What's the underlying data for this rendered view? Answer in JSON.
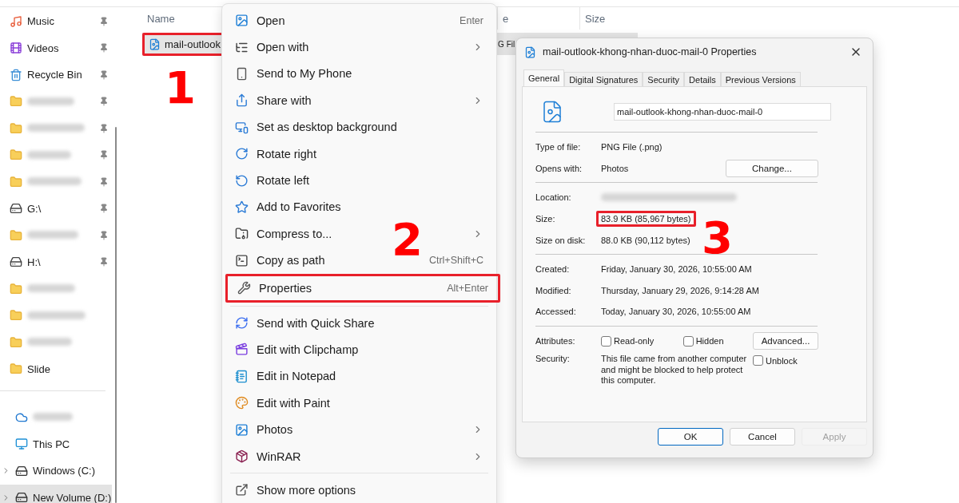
{
  "explorer": {
    "sidebar": {
      "items": [
        {
          "kind": "music",
          "label": "Music",
          "pinned": true,
          "selected": false
        },
        {
          "kind": "videos",
          "label": "Videos",
          "pinned": true,
          "selected": false
        },
        {
          "kind": "recycle",
          "label": "Recycle Bin",
          "pinned": true,
          "selected": false
        },
        {
          "kind": "folder",
          "pinned": true,
          "selected": false
        },
        {
          "kind": "folder",
          "pinned": true,
          "selected": false
        },
        {
          "kind": "folder",
          "pinned": true,
          "selected": false
        },
        {
          "kind": "folder",
          "pinned": true,
          "selected": false
        },
        {
          "kind": "netdrive",
          "label": "G:\\",
          "pinned": true,
          "selected": false
        },
        {
          "kind": "folder",
          "pinned": true,
          "selected": false
        },
        {
          "kind": "netdrive",
          "label": "H:\\",
          "pinned": true,
          "selected": false
        },
        {
          "kind": "folder",
          "pinned": false,
          "selected": false
        },
        {
          "kind": "folder",
          "pinned": false,
          "selected": false
        },
        {
          "kind": "folder",
          "pinned": false,
          "selected": false
        },
        {
          "kind": "folder",
          "label": "Slide",
          "pinned": false,
          "selected": false
        }
      ],
      "computer": [
        {
          "kind": "cloud",
          "selected": false,
          "expandable": false
        },
        {
          "kind": "pc",
          "label": "This PC",
          "selected": false,
          "expandable": false
        },
        {
          "kind": "disk",
          "label": "Windows (C:)",
          "selected": false,
          "expandable": true
        },
        {
          "kind": "disk",
          "label": "New Volume (D:)",
          "selected": true,
          "expandable": true
        }
      ]
    },
    "columns": [
      {
        "label": "Name"
      },
      {
        "label": "e"
      },
      {
        "label": "Size"
      }
    ],
    "files": [
      {
        "name": "mail-outlook",
        "type": "G Fil",
        "selected": true
      }
    ]
  },
  "context_menu": {
    "items": [
      {
        "kind": "item",
        "label": "Open",
        "shortcut": "Enter",
        "submenu": false
      },
      {
        "kind": "item",
        "label": "Open with",
        "submenu": true
      },
      {
        "kind": "item",
        "label": "Send to My Phone",
        "submenu": false
      },
      {
        "kind": "item",
        "label": "Share with",
        "submenu": true
      },
      {
        "kind": "item",
        "label": "Set as desktop background",
        "submenu": false
      },
      {
        "kind": "item",
        "label": "Rotate right",
        "submenu": false
      },
      {
        "kind": "item",
        "label": "Rotate left",
        "submenu": false
      },
      {
        "kind": "item",
        "label": "Add to Favorites",
        "submenu": false
      },
      {
        "kind": "item",
        "label": "Compress to...",
        "submenu": true
      },
      {
        "kind": "item",
        "label": "Copy as path",
        "shortcut": "Ctrl+Shift+C",
        "submenu": false
      },
      {
        "kind": "item",
        "label": "Properties",
        "shortcut": "Alt+Enter",
        "submenu": false
      },
      {
        "kind": "separator"
      },
      {
        "kind": "item",
        "label": "Send with Quick Share",
        "submenu": false
      },
      {
        "kind": "item",
        "label": "Edit with Clipchamp",
        "submenu": false
      },
      {
        "kind": "item",
        "label": "Edit in Notepad",
        "submenu": false
      },
      {
        "kind": "item",
        "label": "Edit with Paint",
        "submenu": false
      },
      {
        "kind": "item",
        "label": "Photos",
        "submenu": true
      },
      {
        "kind": "item",
        "label": "WinRAR",
        "submenu": true
      },
      {
        "kind": "separator"
      },
      {
        "kind": "item",
        "label": "Show more options",
        "submenu": false
      }
    ]
  },
  "properties": {
    "title": "mail-outlook-khong-nhan-duoc-mail-0 Properties",
    "tabs": [
      {
        "label": "General",
        "selected": true
      },
      {
        "label": "Digital Signatures",
        "selected": false
      },
      {
        "label": "Security",
        "selected": false
      },
      {
        "label": "Details",
        "selected": false
      },
      {
        "label": "Previous Versions",
        "selected": false
      }
    ],
    "file_name": "mail-outlook-khong-nhan-duoc-mail-0",
    "sections": [
      [
        {
          "label": "Type of file:",
          "value": "PNG File (.png)"
        },
        {
          "label": "Opens with:",
          "value": "Photos",
          "button": "Change..."
        }
      ],
      [
        {
          "label": "Location:",
          "blurred": true
        },
        {
          "label": "Size:",
          "value": "83.9 KB (85,967 bytes)"
        },
        {
          "label": "Size on disk:",
          "value": "88.0 KB (90,112 bytes)"
        }
      ],
      [
        {
          "label": "Created:",
          "value": "Friday, January 30, 2026, 10:55:00 AM"
        },
        {
          "label": "Modified:",
          "value": "Thursday, January 29, 2026, 9:14:28 AM"
        },
        {
          "label": "Accessed:",
          "value": "Today, January 30, 2026, 10:55:00 AM"
        }
      ]
    ],
    "attributes": {
      "label": "Attributes:",
      "checks": [
        {
          "label": "Read-only",
          "checked": false
        },
        {
          "label": "Hidden",
          "checked": false
        }
      ],
      "button": "Advanced..."
    },
    "security": {
      "label": "Security:",
      "text": "This file came from another computer and might be blocked to help protect this computer.",
      "check": {
        "label": "Unblock",
        "checked": false
      }
    },
    "buttons": [
      {
        "label": "OK",
        "kind": "default"
      },
      {
        "label": "Cancel",
        "kind": "normal"
      },
      {
        "label": "Apply",
        "kind": "disabled"
      }
    ]
  },
  "annotations": [
    {
      "number": "1"
    },
    {
      "number": "2"
    },
    {
      "number": "3"
    }
  ]
}
